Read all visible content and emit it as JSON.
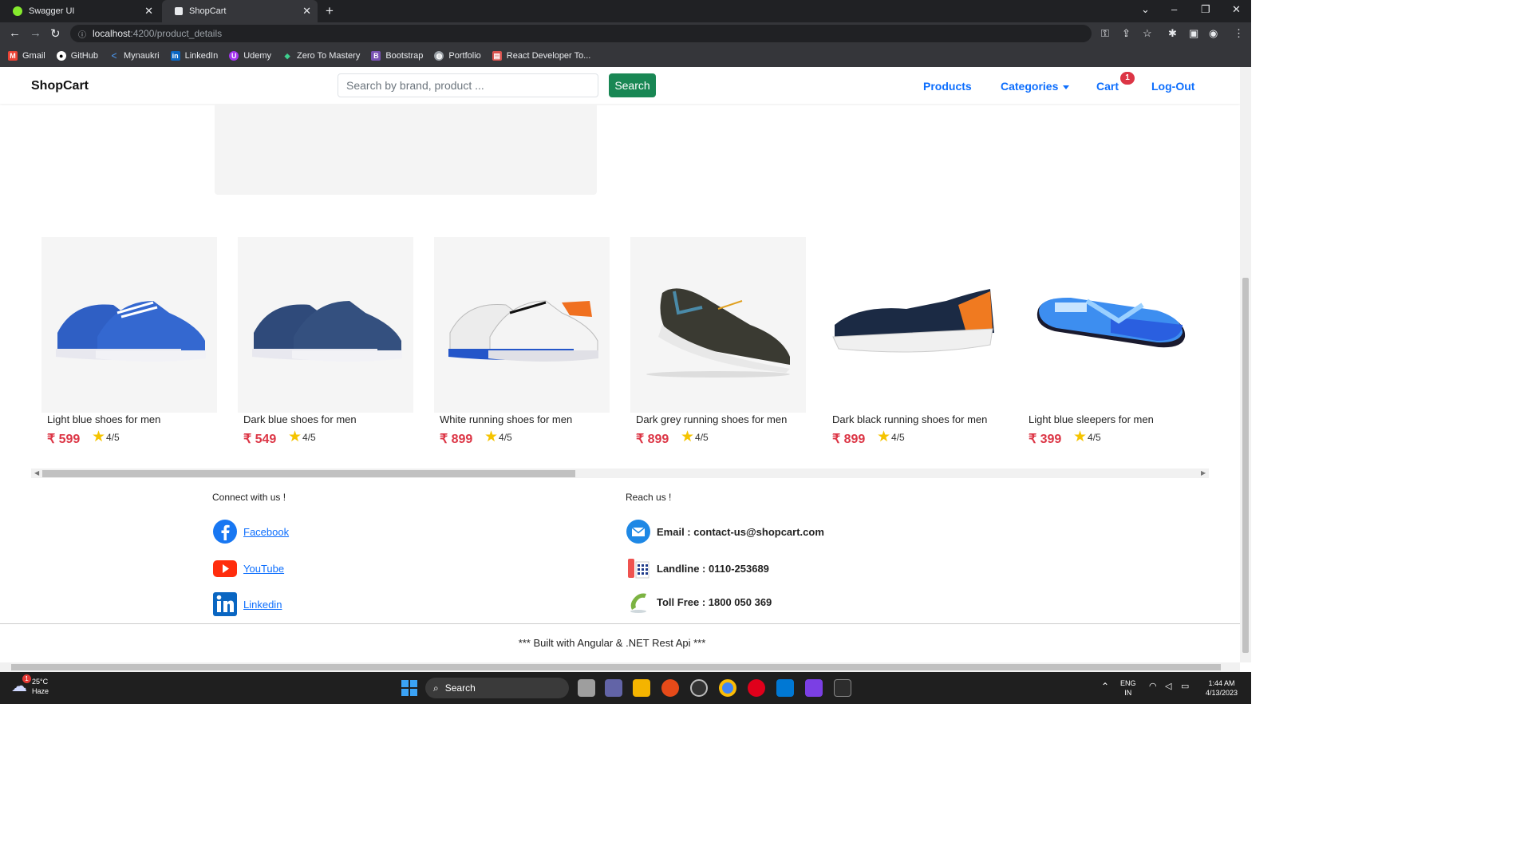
{
  "browser": {
    "tabs": [
      {
        "label": "Swagger UI",
        "active": false
      },
      {
        "label": "ShopCart",
        "active": true
      }
    ],
    "url_host": "localhost",
    "url_path": ":4200/product_details",
    "bookmarks": [
      "Gmail",
      "GitHub",
      "Mynaukri",
      "LinkedIn",
      "Udemy",
      "Zero To Mastery",
      "Bootstrap",
      "Portfolio",
      "React Developer To..."
    ]
  },
  "navbar": {
    "brand": "ShopCart",
    "search_placeholder": "Search by brand, product ...",
    "search_button": "Search",
    "links": {
      "products": "Products",
      "categories": "Categories",
      "cart": "Cart",
      "logout": "Log-Out"
    },
    "cart_count": "1"
  },
  "products": [
    {
      "name": "Light blue shoes for men",
      "price": "₹ 599",
      "rating": "4/5",
      "color": "#2f5fc4"
    },
    {
      "name": "Dark blue shoes for men",
      "price": "₹ 549",
      "rating": "4/5",
      "color": "#2f4a7a"
    },
    {
      "name": "White running shoes for men",
      "price": "₹ 899",
      "rating": "4/5",
      "color": "#e8e8e8"
    },
    {
      "name": "Dark grey running shoes for men",
      "price": "₹ 899",
      "rating": "4/5",
      "color": "#3a3a32"
    },
    {
      "name": "Dark black running shoes for men",
      "price": "₹ 899",
      "rating": "4/5",
      "color": "#1b2a44"
    },
    {
      "name": "Light blue sleepers for men",
      "price": "₹ 399",
      "rating": "4/5",
      "color": "#3d8ef0"
    }
  ],
  "footer": {
    "connect_heading": "Connect with us !",
    "reach_heading": "Reach us !",
    "social": {
      "facebook": "Facebook",
      "youtube": "YouTube",
      "linkedin": "Linkedin"
    },
    "email": "Email : contact-us@shopcart.com",
    "landline": "Landline : 0110-253689",
    "tollfree": "Toll Free : 1800 050 369",
    "credits": "*** Built with Angular & .NET Rest Api ***"
  },
  "taskbar": {
    "temperature": "25°C",
    "weather": "Haze",
    "weather_badge": "1",
    "search": "Search",
    "lang": "ENG",
    "region": "IN",
    "time": "1:44 AM",
    "date": "4/13/2023"
  }
}
